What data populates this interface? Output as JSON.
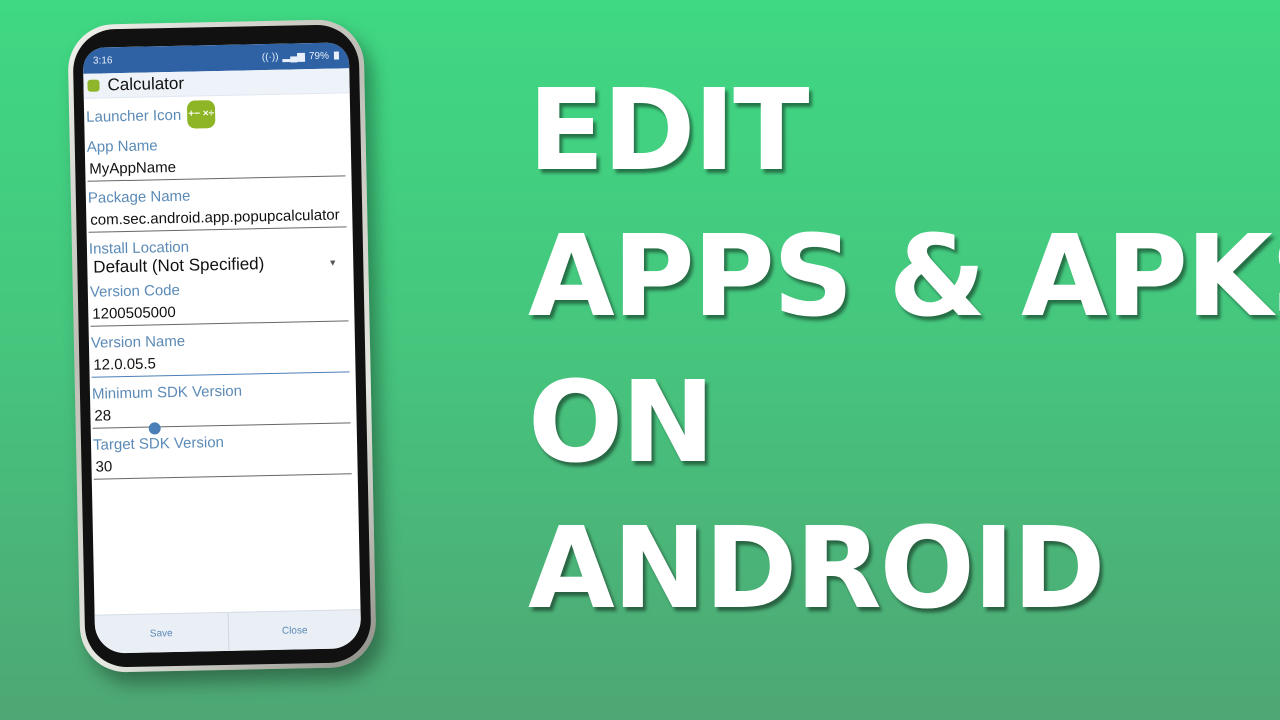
{
  "headline": {
    "lines": [
      "EDIT",
      "APPS & APKS",
      "ON",
      "ANDROID"
    ]
  },
  "phone": {
    "statusbar": {
      "time": "3:16",
      "battery": "79%",
      "icons": [
        "hotspot-icon",
        "volte-icon",
        "4g-icon",
        "signal-icon",
        "signal-icon",
        "battery-icon"
      ]
    },
    "app": {
      "title": "Calculator",
      "launcher_icon_label": "Launcher Icon",
      "launcher_icon_glyph": "+− ×÷",
      "fields": [
        {
          "label": "App Name",
          "value": "MyAppName"
        },
        {
          "label": "Package Name",
          "value": "com.sec.android.app.popupcalculator"
        },
        {
          "label": "Install Location",
          "value": "Default (Not Specified)",
          "type": "select"
        },
        {
          "label": "Version Code",
          "value": "1200505000"
        },
        {
          "label": "Version Name",
          "value": "12.0.05.5",
          "focused": true
        },
        {
          "label": "Minimum SDK Version",
          "value": "28"
        },
        {
          "label": "Target SDK Version",
          "value": "30"
        }
      ],
      "buttons": {
        "save": "Save",
        "close": "Close"
      }
    }
  },
  "colors": {
    "background": "#41cf80",
    "statusbar": "#2f62a4",
    "label": "#5b8ab6",
    "accent": "#8db526"
  }
}
